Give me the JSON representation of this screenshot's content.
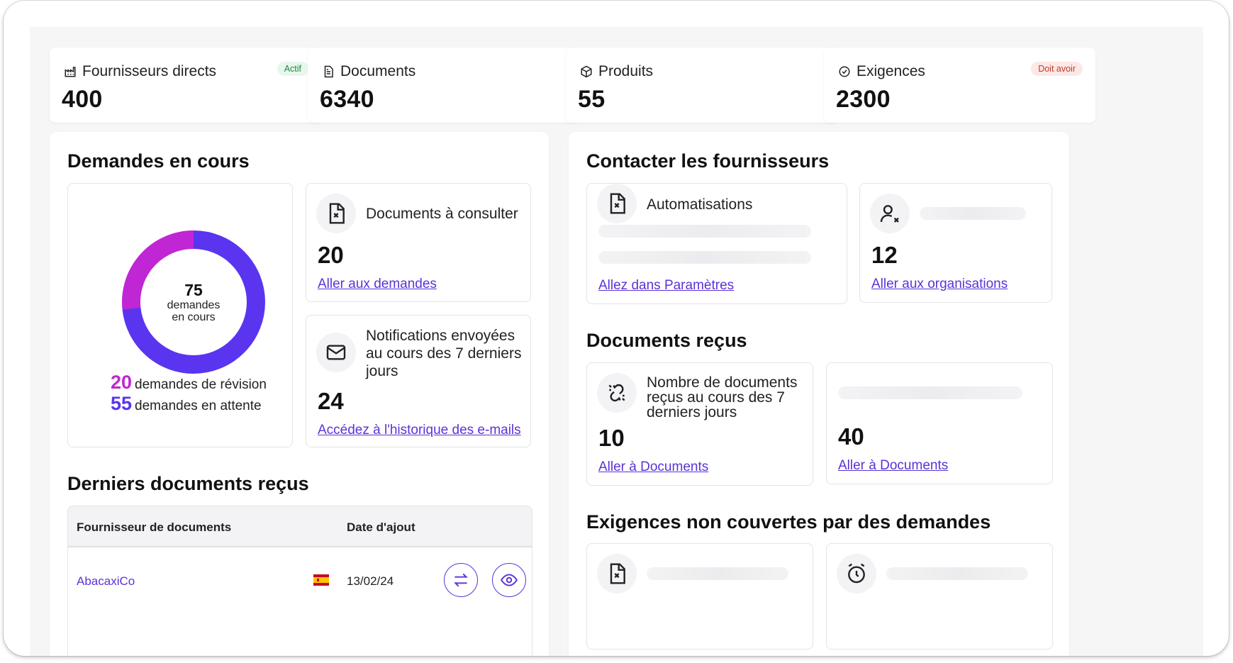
{
  "stats": [
    {
      "label": "Fournisseurs directs",
      "value": "400",
      "badge": "Actif",
      "icon": "factory-icon"
    },
    {
      "label": "Documents",
      "value": "6340",
      "badge": "",
      "icon": "document-icon"
    },
    {
      "label": "Produits",
      "value": "55",
      "badge": "",
      "icon": "box-icon"
    },
    {
      "label": "Exigences",
      "value": "2300",
      "badge": "Doit avoir",
      "icon": "check-circle-icon"
    }
  ],
  "requests": {
    "title": "Demandes en cours",
    "donut": {
      "total": "75",
      "total_label_1": "demandes",
      "total_label_2": "en cours",
      "segments": [
        {
          "label": "demandes de révision",
          "value": 20,
          "color": "#c026d3"
        },
        {
          "label": "demandes en attente",
          "value": 55,
          "color": "#5b34f0"
        }
      ]
    },
    "legend": [
      {
        "value": "20",
        "label": "demandes de révision",
        "color": "#c026d3"
      },
      {
        "value": "55",
        "label": "demandes en attente",
        "color": "#5b34f0"
      }
    ],
    "docs_card": {
      "title": "Documents à consulter",
      "value": "20",
      "link": "Aller aux demandes",
      "icon": "file-x-icon"
    },
    "notif_card": {
      "title_1": "Notifications envoyées",
      "title_2": "au cours des 7 derniers",
      "title_3": "jours",
      "value": "24",
      "link": "Accédez à l'historique des e-mails",
      "icon": "mail-icon"
    }
  },
  "latest": {
    "title": "Derniers documents reçus",
    "columns": [
      "Fournisseur de documents",
      "Date d'ajout"
    ],
    "rows": [
      {
        "supplier": "AbacaxiCo",
        "flag": "spain-flag-icon",
        "date": "13/02/24"
      }
    ]
  },
  "contact": {
    "title": "Contacter les fournisseurs",
    "auto_card": {
      "title": "Automatisations",
      "link": "Allez dans Paramètres",
      "icon": "file-x-icon"
    },
    "orgs_card": {
      "value": "12",
      "link": "Aller aux organisations",
      "icon": "user-x-icon"
    }
  },
  "received": {
    "title": "Documents reçus",
    "count_card": {
      "title_1": "Nombre de documents",
      "title_2": "reçus au cours des 7",
      "title_3": "derniers jours",
      "value": "10",
      "link": "Aller à Documents",
      "icon": "broken-link-icon"
    },
    "other_card": {
      "value": "40",
      "link": "Aller à Documents"
    }
  },
  "uncovered": {
    "title": "Exigences non couvertes par des demandes"
  },
  "colors": {
    "accent": "#5b32d6",
    "purple": "#5b34f0",
    "magenta": "#c026d3"
  }
}
